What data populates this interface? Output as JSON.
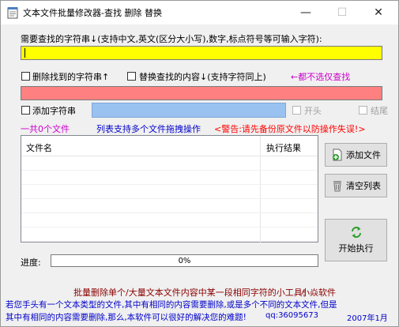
{
  "window": {
    "title": "文本文件批量修改器-查找 删除 替换",
    "minimize_glyph": "—",
    "maximize_glyph": "☐",
    "close_glyph": "✕"
  },
  "find": {
    "label": "需要查找的字符串↓(支持中文,英文(区分大小写),数字,标点符号等可输入字符):",
    "value": ""
  },
  "options": {
    "delete_found_label": "删除找到的字符串↑",
    "replace_label": "替换查找的内容↓(支持字符同上)",
    "none_selected_hint": "←都不选仅查找",
    "add_string_label": "添加字符串",
    "start_label": "开头",
    "end_label": "结尾"
  },
  "info": {
    "file_count": "一共0个文件",
    "drag_hint": "列表支持多个文件拖拽操作",
    "warning": "<警告:请先备份原文件以防操作失误!>"
  },
  "list": {
    "columns": [
      "文件名",
      "执行结果"
    ]
  },
  "buttons": {
    "add_file": "添加文件",
    "clear_list": "清空列表",
    "run": "开始执行"
  },
  "progress": {
    "label": "进度:",
    "value": 0,
    "text": "0%"
  },
  "footer": {
    "slogan_left": "批量删除单个/大量文本文件内容中某一段相同字符的小工具!",
    "slogan_right": "小焱软件",
    "desc_line1": "若您手头有一个文本类型的文件,其中有相同的内容需要删除,或是多个不同的文本文件,但是",
    "desc_line2": "其中有相同的内容需要删除,那么,本软件可以很好的解决您的难题!",
    "contact": "qq:36095673",
    "date": "2007年1月"
  },
  "colors": {
    "find_bg": "#ffff00",
    "replace_bg": "#ff8080",
    "add_bg": "#99c2f0",
    "purple": "#cc00cc",
    "blue": "#0000cc",
    "red": "#ff0000",
    "dark_red": "#8b0000",
    "progress_fill": "#06b025"
  },
  "icons": {
    "app": "notepad-icon",
    "add_file": "add-file-icon",
    "clear_list": "trash-icon",
    "run": "refresh-arrows-icon"
  }
}
